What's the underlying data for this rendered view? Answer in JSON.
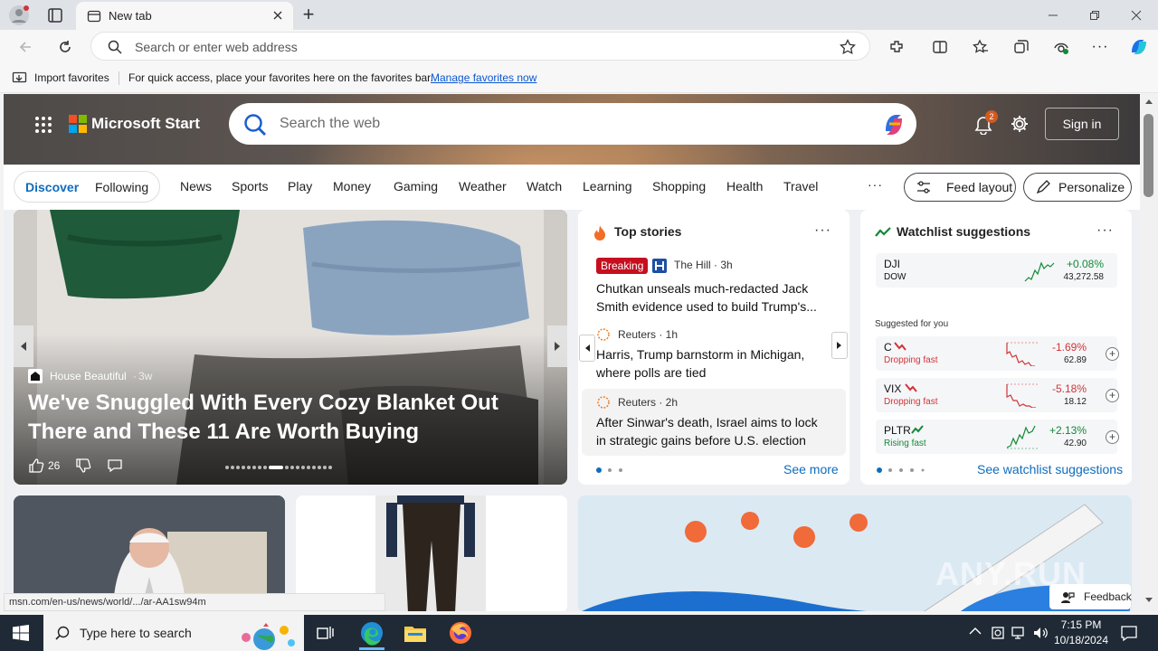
{
  "browser": {
    "tab_title": "New tab",
    "address_placeholder": "Search or enter web address",
    "favbar": {
      "import_label": "Import favorites",
      "message": "For quick access, place your favorites here on the favorites bar.",
      "manage_link": "Manage favorites now"
    },
    "status_url": "msn.com/en-us/news/world/.../ar-AA1sw94m"
  },
  "page": {
    "brand": "Microsoft Start",
    "search_placeholder": "Search the web",
    "notification_count": "2",
    "sign_in": "Sign in",
    "toggle": {
      "discover": "Discover",
      "following": "Following"
    },
    "nav": [
      "News",
      "Sports",
      "Play",
      "Money",
      "Gaming",
      "Weather",
      "Watch",
      "Learning",
      "Shopping",
      "Health",
      "Travel"
    ],
    "more": "···",
    "feed_layout": "Feed layout",
    "personalize": "Personalize"
  },
  "featured": {
    "source": "House Beautiful",
    "age": "3w",
    "headline": "We've Snuggled With Every Cozy Blanket Out There and These 11 Are Worth Buying",
    "likes": "26"
  },
  "top_stories": {
    "title": "Top stories",
    "items": [
      {
        "badge": "Breaking",
        "source": "The Hill · 3h",
        "headline": "Chutkan unseals much-redacted Jack Smith evidence used to build Trump's..."
      },
      {
        "source": "Reuters · 1h",
        "headline": "Harris, Trump barnstorm in Michigan, where polls are tied"
      },
      {
        "source": "Reuters · 2h",
        "headline": "After Sinwar's death, Israel aims to lock in strategic gains before U.S. election"
      }
    ],
    "see_more": "See more"
  },
  "watchlist": {
    "title": "Watchlist suggestions",
    "index": {
      "symbol": "DJI",
      "name": "DOW",
      "change": "+0.08%",
      "price": "43,272.58"
    },
    "suggested_label": "Suggested for you",
    "stocks": [
      {
        "symbol": "C",
        "trend": "Dropping fast",
        "change": "-1.69%",
        "price": "62.89"
      },
      {
        "symbol": "VIX",
        "trend": "Dropping fast",
        "change": "-5.18%",
        "price": "18.12"
      },
      {
        "symbol": "PLTR",
        "trend": "Rising fast",
        "change": "+2.13%",
        "price": "42.90"
      }
    ],
    "see_link": "See watchlist suggestions",
    "colors": {
      "up": "#138a36",
      "down": "#d13438"
    }
  },
  "feedback": "Feedback",
  "watermark": "ANY.RUN",
  "taskbar": {
    "search_placeholder": "Type here to search",
    "time": "7:15 PM",
    "date": "10/18/2024"
  }
}
